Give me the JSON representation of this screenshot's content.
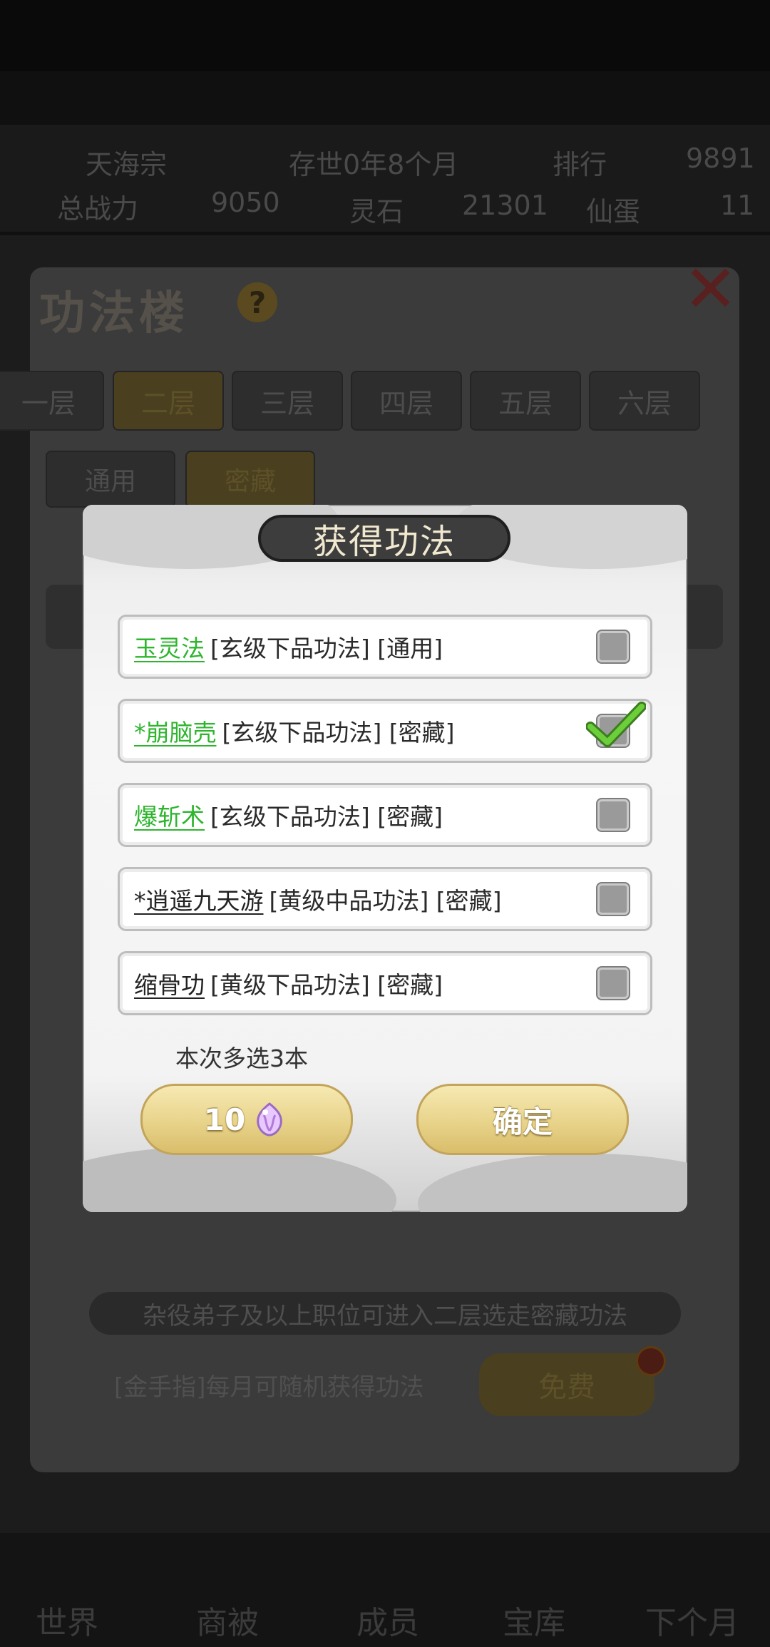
{
  "background": {
    "stats": {
      "sect_name": "天海宗",
      "existence": "存世0年8个月",
      "ranking_label": "排行",
      "ranking_value": "9891",
      "power_label": "总战力",
      "power_value": "9050",
      "spirit_stone_label": "灵石",
      "spirit_stone_value": "21301",
      "egg_label": "仙蛋",
      "egg_value": "11"
    },
    "hall_title": "功法楼",
    "help_symbol": "?",
    "floor_tabs": [
      "一层",
      "二层",
      "三层",
      "四层",
      "五层",
      "六层"
    ],
    "category_tabs": [
      "通用",
      "密藏"
    ],
    "notice": "杂役弟子及以上职位可进入二层选走密藏功法",
    "golden_finger_text": "[金手指]每月可随机获得功法",
    "free_button": "免费",
    "nav": [
      "世界",
      "商被",
      "成员",
      "宝库",
      "下个月"
    ]
  },
  "dialog": {
    "title": "获得功法",
    "options": [
      {
        "name": "玉灵法",
        "info": "[玄级下品功法] [通用]",
        "name_color": "#2db52d",
        "checked": false
      },
      {
        "name": "*崩脑壳",
        "info": "[玄级下品功法] [密藏]",
        "name_color": "#2db52d",
        "checked": true
      },
      {
        "name": "爆斩术",
        "info": "[玄级下品功法] [密藏]",
        "name_color": "#2db52d",
        "checked": false
      },
      {
        "name": "*逍遥九天游",
        "info": "[黄级中品功法] [密藏]",
        "name_color": "#222222",
        "checked": false
      },
      {
        "name": "缩骨功",
        "info": "[黄级下品功法] [密藏]",
        "name_color": "#222222",
        "checked": false
      }
    ],
    "hint": "本次多选3本",
    "refresh_cost": "10",
    "refresh_icon": "crystal-icon",
    "confirm_label": "确定"
  },
  "colors": {
    "accent_gold": "#e8d38a",
    "green_name": "#2db52d",
    "check_green": "#6ccf3a"
  }
}
